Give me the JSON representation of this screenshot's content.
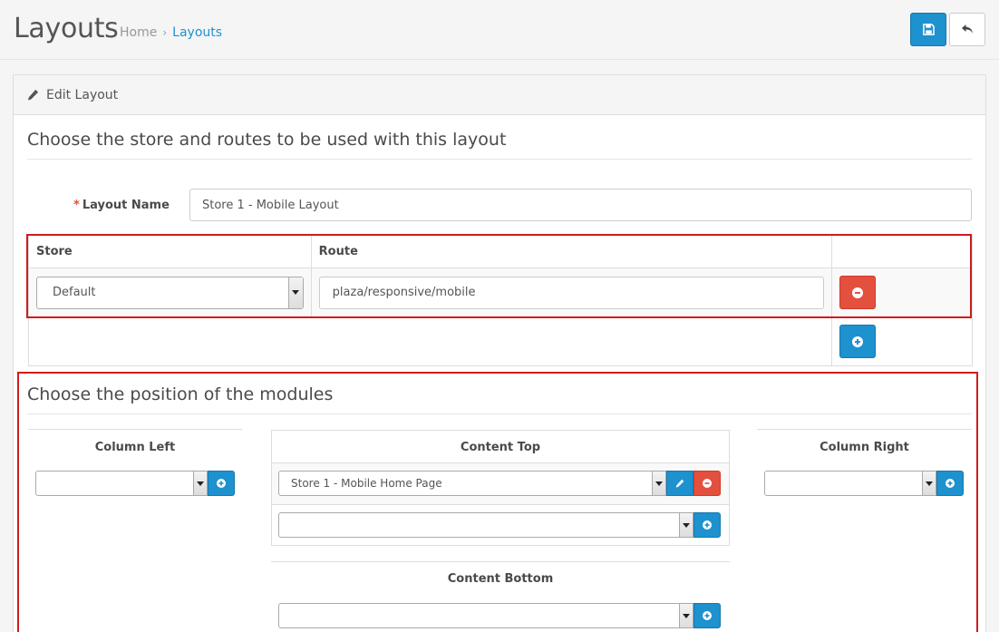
{
  "header": {
    "title": "Layouts",
    "breadcrumb": [
      {
        "label": "Home"
      },
      {
        "label": "Layouts"
      }
    ],
    "save_icon": "save-icon",
    "back_icon": "reply-icon"
  },
  "panel": {
    "title": "Edit Layout",
    "title_icon": "pencil-icon"
  },
  "routes_section": {
    "legend": "Choose the store and routes to be used with this layout",
    "layout_name_label": "Layout Name",
    "layout_name_value": "Store 1 - Mobile Layout",
    "columns": [
      "Store",
      "Route",
      ""
    ],
    "rows": [
      {
        "store": "Default",
        "route": "plaza/responsive/mobile"
      }
    ]
  },
  "modules_section": {
    "legend": "Choose the position of the modules",
    "column_left": {
      "title": "Column Left",
      "selected": ""
    },
    "content_top": {
      "title": "Content Top",
      "modules": [
        "Store 1 - Mobile Home Page"
      ],
      "new_selected": ""
    },
    "column_right": {
      "title": "Column Right",
      "selected": ""
    },
    "content_bottom": {
      "title": "Content Bottom",
      "selected": ""
    }
  },
  "colors": {
    "primary": "#1e91cf",
    "danger": "#e3503e",
    "highlight": "#d01c1c"
  }
}
